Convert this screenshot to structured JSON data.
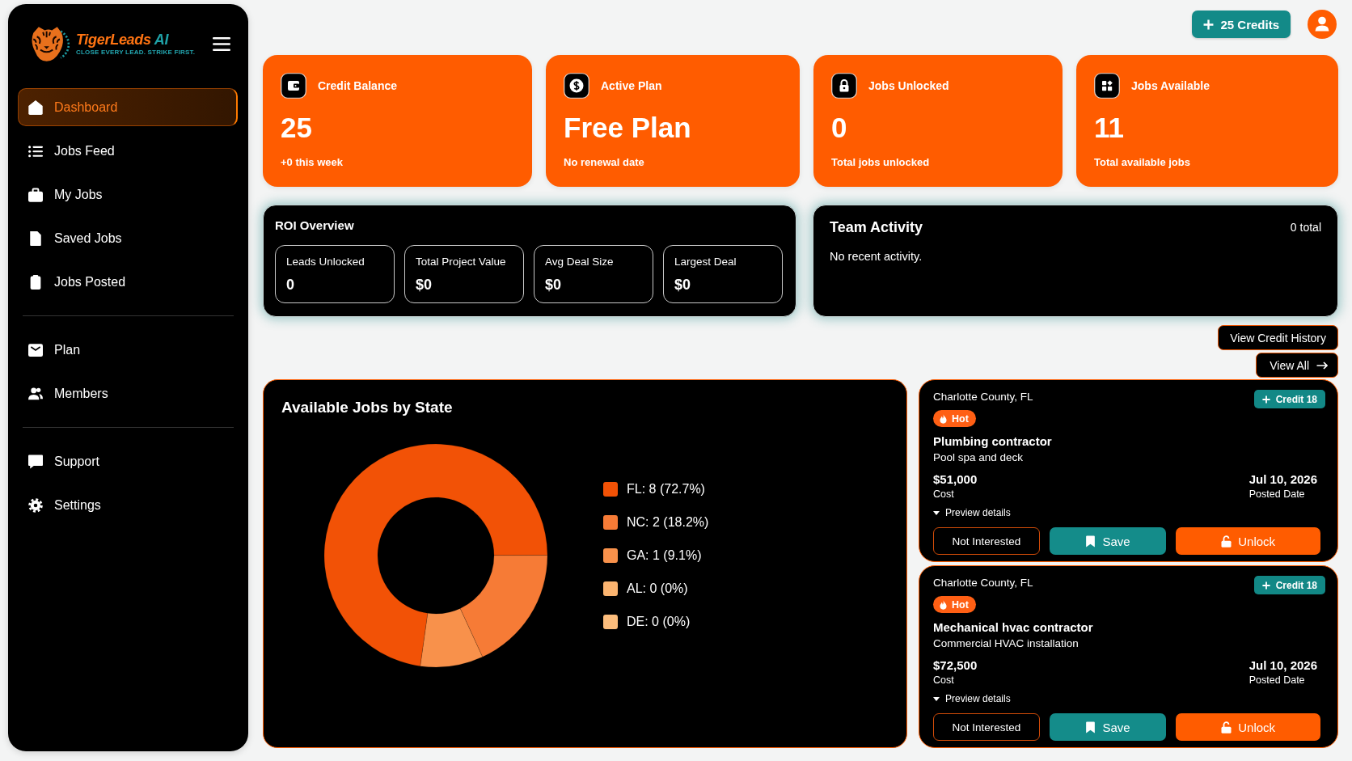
{
  "sidebar": {
    "logo": {
      "name": "TigerLeads",
      "suffix": "AI",
      "tagline": "CLOSE EVERY LEAD. STRIKE FIRST."
    },
    "sections": [
      {
        "items": [
          {
            "label": "Dashboard",
            "selected": true
          },
          {
            "label": "Jobs Feed",
            "selected": false
          },
          {
            "label": "My Jobs",
            "selected": false
          },
          {
            "label": "Saved Jobs",
            "selected": false
          },
          {
            "label": "Jobs Posted",
            "selected": false
          }
        ]
      },
      {
        "items": [
          {
            "label": "Plan",
            "selected": false
          },
          {
            "label": "Members",
            "selected": false
          }
        ]
      },
      {
        "items": [
          {
            "label": "Support",
            "selected": false
          },
          {
            "label": "Settings",
            "selected": false
          }
        ]
      }
    ]
  },
  "header": {
    "credits_button": "25 Credits"
  },
  "stats": [
    {
      "title": "Credit Balance",
      "value": "25",
      "note": "+0 this week"
    },
    {
      "title": "Active Plan",
      "value": "Free Plan",
      "note": "No renewal date"
    },
    {
      "title": "Jobs Unlocked",
      "value": "0",
      "note": "Total jobs unlocked"
    },
    {
      "title": "Jobs Available",
      "value": "11",
      "note": "Total available jobs"
    }
  ],
  "roi_overview": {
    "title": "ROI Overview",
    "metrics": [
      {
        "label": "Leads Unlocked",
        "value": "0"
      },
      {
        "label": "Total Project Value",
        "value": "$0"
      },
      {
        "label": "Avg Deal Size",
        "value": "$0"
      },
      {
        "label": "Largest Deal",
        "value": "$0"
      }
    ]
  },
  "team_activity": {
    "title": "Team Activity",
    "count": "0 total",
    "empty_text": "No recent activity."
  },
  "view_credit_history_button": "View Credit History",
  "view_all_button": "View All",
  "jobs_by_state": {
    "chart_data": {
      "type": "donut",
      "title": "Available Jobs by State",
      "categories": [
        "FL: 8 (72.7%)",
        "NC: 2 (18.2%)",
        "GA: 1 (9.1%)",
        "AL: 0 (0%)",
        "DE: 0 (0%)"
      ],
      "values": [
        8,
        2,
        1,
        0,
        0
      ],
      "legend": "right"
    },
    "slices": [
      {
        "color": "#f25206"
      },
      {
        "color": "#f67b36"
      },
      {
        "color": "#f8914b"
      },
      {
        "color": "#fbb470"
      },
      {
        "color": "#fcbd7c"
      }
    ]
  },
  "jobs": [
    {
      "location": "Charlotte County, FL",
      "credit": "Credit 18",
      "tag": "Hot",
      "title": "Plumbing contractor",
      "description": "Pool spa and deck",
      "price": "$51,000",
      "price_label": "Cost",
      "date": "Jul 10, 2026",
      "date_label": "Posted Date",
      "preview": "Preview details",
      "actions": [
        {
          "label": "Not Interested",
          "kind": "dismiss"
        },
        {
          "label": "Save",
          "kind": "save"
        },
        {
          "label": "Unlock",
          "kind": "unlock"
        }
      ]
    },
    {
      "location": "Charlotte County, FL",
      "credit": "Credit 18",
      "tag": "Hot",
      "title": "Mechanical hvac contractor",
      "description": "Commercial HVAC installation",
      "price": "$72,500",
      "price_label": "Cost",
      "date": "Jul 10, 2026",
      "date_label": "Posted Date",
      "preview": "Preview details",
      "actions": [
        {
          "label": "Not Interested",
          "kind": "dismiss"
        },
        {
          "label": "Save",
          "kind": "save"
        },
        {
          "label": "Unlock",
          "kind": "unlock"
        }
      ]
    }
  ]
}
